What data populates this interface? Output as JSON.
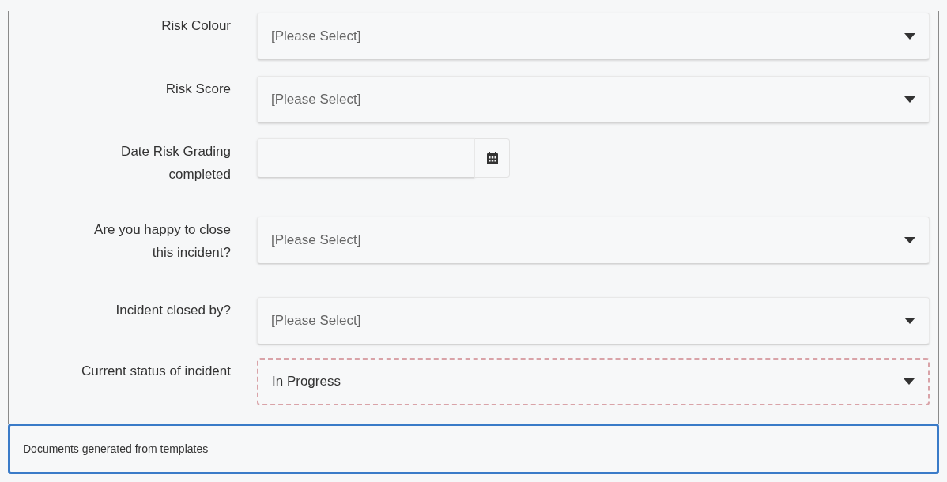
{
  "fields": [
    {
      "kind": "select",
      "label": "Risk Colour",
      "placeholder": "[Please Select]",
      "invalid": false
    },
    {
      "kind": "select",
      "label": "Risk Score",
      "placeholder": "[Please Select]",
      "invalid": false
    },
    {
      "kind": "date",
      "label": "Date Risk Grading\ncompleted",
      "invalid": false
    },
    {
      "kind": "select",
      "label": "Are you happy to close\nthis incident?",
      "placeholder": "[Please Select]",
      "invalid": false
    },
    {
      "kind": "select",
      "label": "Incident closed by?",
      "placeholder": "[Please Select]",
      "invalid": false
    },
    {
      "kind": "select",
      "label": "Current status of incident",
      "value": "In Progress",
      "invalid": true
    }
  ],
  "section": {
    "title": "Documents generated from templates"
  }
}
